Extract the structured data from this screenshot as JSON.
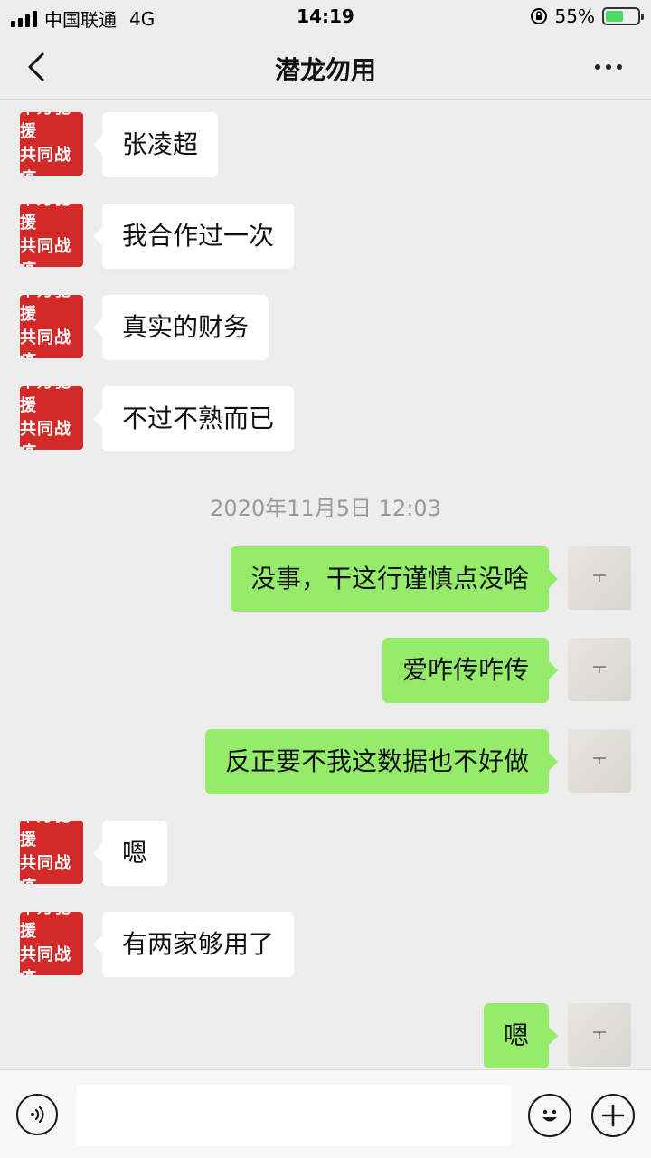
{
  "status_bar": {
    "carrier": "中国联通",
    "network": "4G",
    "time": "14:19",
    "battery": "55%",
    "battery_level": 0.55
  },
  "header": {
    "title": "潜龙勿用",
    "back_icon": "chevron-left-icon",
    "more_icon": "more-dots-icon"
  },
  "contact_avatar": {
    "line1": "千万驰援",
    "line2": "共同战疫"
  },
  "messages": [
    {
      "side": "left",
      "text": "张凌超"
    },
    {
      "side": "left",
      "text": "我合作过一次"
    },
    {
      "side": "left",
      "text": "真实的财务"
    },
    {
      "side": "left",
      "text": "不过不熟而已"
    },
    {
      "side": "timestamp",
      "text": "2020年11月5日 12:03"
    },
    {
      "side": "right",
      "text": "没事，干这行谨慎点没啥"
    },
    {
      "side": "right",
      "text": "爱咋传咋传"
    },
    {
      "side": "right",
      "text": "反正要不我这数据也不好做"
    },
    {
      "side": "left",
      "text": "嗯"
    },
    {
      "side": "left",
      "text": "有两家够用了"
    },
    {
      "side": "right",
      "text": "嗯"
    }
  ],
  "input_bar": {
    "voice_icon": "voice-icon",
    "emoji_icon": "emoji-icon",
    "plus_icon": "plus-icon",
    "placeholder": ""
  },
  "colors": {
    "background": "#ededed",
    "bubble_self": "#95ec69",
    "bubble_other": "#ffffff",
    "avatar_red": "#d42a27"
  }
}
